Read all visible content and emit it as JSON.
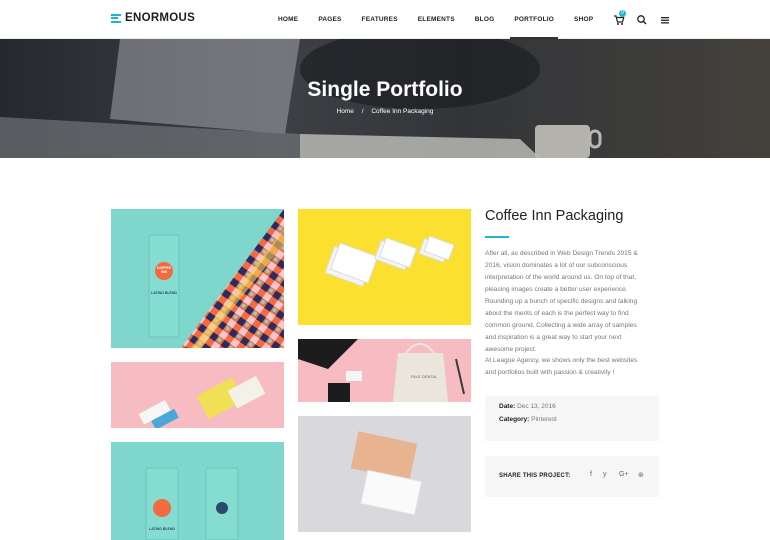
{
  "brand": {
    "name": "ENORMOUS"
  },
  "nav": {
    "items": [
      {
        "label": "HOME"
      },
      {
        "label": "PAGES"
      },
      {
        "label": "FEATURES"
      },
      {
        "label": "ELEMENTS"
      },
      {
        "label": "BLOG"
      },
      {
        "label": "PORTFOLIO"
      },
      {
        "label": "SHOP"
      }
    ],
    "active": "PORTFOLIO"
  },
  "header_icons": {
    "cart_badge": "0",
    "icons": [
      "cart-icon",
      "search-icon",
      "menu-icon"
    ]
  },
  "hero": {
    "title": "Single Portfolio",
    "breadcrumb_home": "Home",
    "breadcrumb_separator": "/",
    "breadcrumb_current": "Coffee Inn Packaging"
  },
  "project": {
    "title": "Coffee Inn Packaging",
    "description_lines_1": [
      "After all, as described in Web Design Trends 2015 &",
      "2016, vision dominates a lot of our subconscious",
      "interpretation of the world around us. On top of that,",
      "pleasing images create a better user experience.",
      "Rounding up a bunch of specific designs and talking",
      "about the merits of each is the perfect way to find",
      "common ground. Collecting a wide array of samples",
      "and inspiration is a great way to start your next",
      "awesome project."
    ],
    "description_lines_2": [
      "At League Agency, we shows only the best websites",
      "and portfolios built with passion & creativity !"
    ],
    "date_label": "Date:",
    "date_value": "Dec 13, 2016",
    "category_label": "Category:",
    "category_value": "Pinterest",
    "share_label": "SHARE THIS PROJECT:",
    "share_icons": [
      {
        "name": "facebook-icon",
        "glyph": "f"
      },
      {
        "name": "twitter-icon",
        "glyph": "y"
      },
      {
        "name": "google-plus-icon",
        "glyph": "G+"
      },
      {
        "name": "pinterest-icon",
        "glyph": "⊛"
      }
    ],
    "bag_text": {
      "brand_line1": "COFFEE",
      "brand_line2": "INN",
      "blend": "LATINO BLEND"
    },
    "box_text": "PALE DENTAL"
  },
  "colors": {
    "accent": "#1fb3d6",
    "mint": "#7fd6cc",
    "yellow": "#fbe02f",
    "pink": "#f6bcc2",
    "gray": "#d9d9dd",
    "orange": "#f26a3d"
  }
}
